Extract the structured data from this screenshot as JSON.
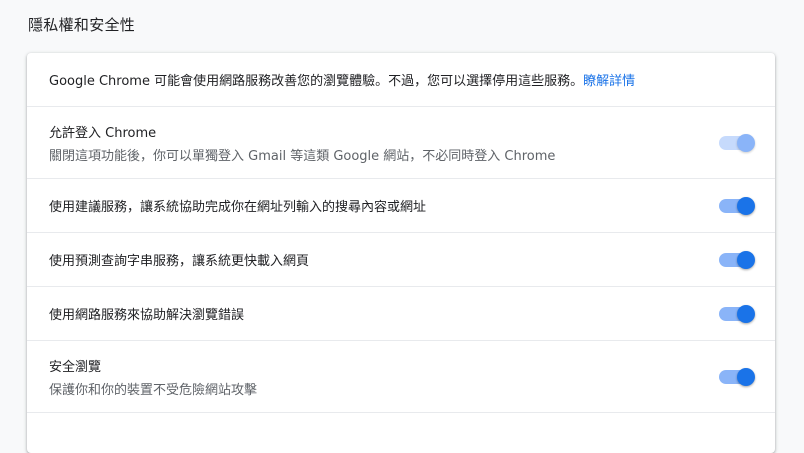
{
  "section_title": "隱私權和安全性",
  "intro": {
    "text": "Google Chrome 可能會使用網路服務改善您的瀏覽體驗。不過，您可以選擇停用這些服務。",
    "link": "瞭解詳情"
  },
  "settings": [
    {
      "label": "允許登入 Chrome",
      "sub": "關閉這項功能後，你可以單獨登入 Gmail 等這類 Google 網站，不必同時登入 Chrome",
      "enabled": true,
      "disabled": true
    },
    {
      "label": "使用建議服務，讓系統協助完成你在網址列輸入的搜尋內容或網址",
      "enabled": true
    },
    {
      "label": "使用預測查詢字串服務，讓系統更快載入網頁",
      "enabled": true
    },
    {
      "label": "使用網路服務來協助解決瀏覽錯誤",
      "enabled": true
    },
    {
      "label": "安全瀏覽",
      "sub": "保護你和你的裝置不受危險網站攻擊",
      "enabled": true
    }
  ],
  "colors": {
    "accent": "#1a73e8",
    "track": "#8ab4f8"
  }
}
